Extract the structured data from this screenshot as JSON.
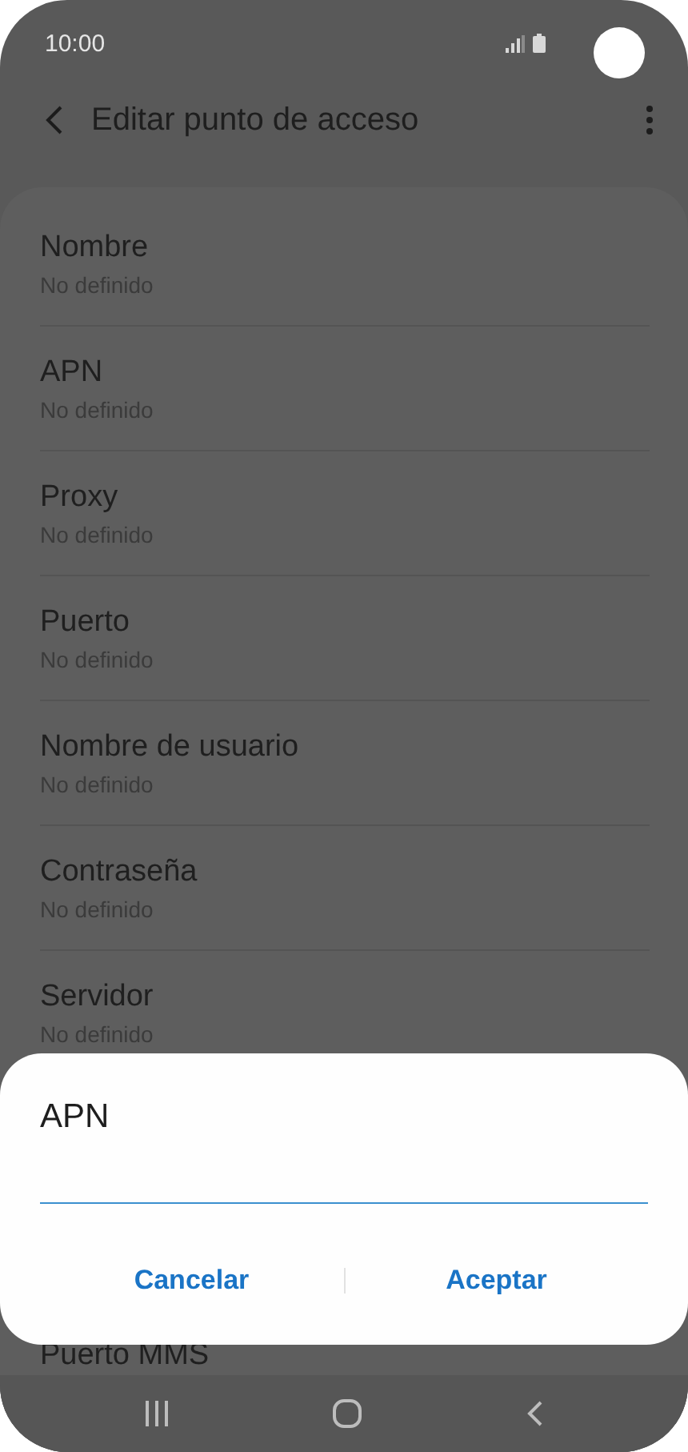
{
  "status_bar": {
    "time": "10:00"
  },
  "header": {
    "title": "Editar punto de acceso"
  },
  "items": [
    {
      "title": "Nombre",
      "subtitle": "No definido"
    },
    {
      "title": "APN",
      "subtitle": "No definido"
    },
    {
      "title": "Proxy",
      "subtitle": "No definido"
    },
    {
      "title": "Puerto",
      "subtitle": "No definido"
    },
    {
      "title": "Nombre de usuario",
      "subtitle": "No definido"
    },
    {
      "title": "Contraseña",
      "subtitle": "No definido"
    },
    {
      "title": "Servidor",
      "subtitle": "No definido"
    },
    {
      "title": "Puerto MMS"
    }
  ],
  "dialog": {
    "title": "APN",
    "buttons": [
      "Cancelar",
      "Aceptar"
    ]
  }
}
